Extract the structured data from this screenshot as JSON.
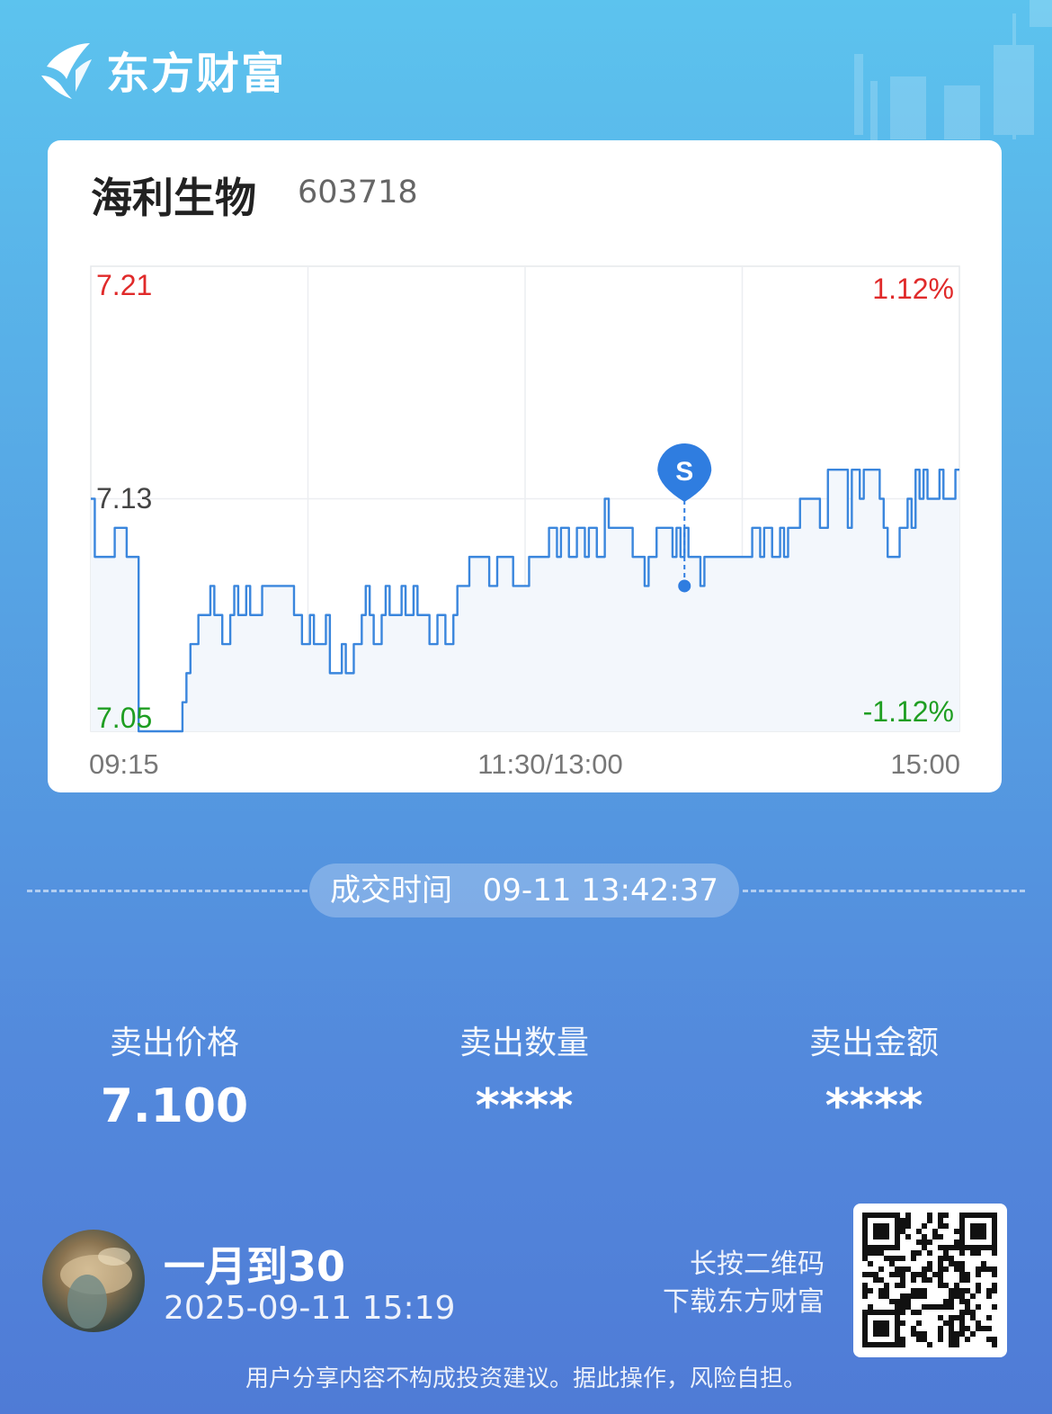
{
  "brand": {
    "name": "东方财富"
  },
  "stock": {
    "name": "海利生物",
    "code": "603718"
  },
  "chart_data": {
    "type": "line",
    "series_name": "",
    "y_top": "7.21",
    "y_mid": "7.13",
    "y_bottom": "7.05",
    "pct_top": "1.12%",
    "pct_bottom": "-1.12%",
    "x_labels": [
      "09:15",
      "11:30/13:00",
      "15:00"
    ],
    "ylim": [
      7.05,
      7.21
    ],
    "prev_close": 7.13,
    "trade_marker": {
      "label": "S",
      "x_index": 149,
      "value": 7.1
    },
    "values": [
      7.13,
      7.11,
      7.11,
      7.11,
      7.11,
      7.11,
      7.12,
      7.12,
      7.12,
      7.11,
      7.11,
      7.11,
      7.05,
      7.05,
      7.05,
      7.05,
      7.05,
      7.05,
      7.05,
      7.05,
      7.05,
      7.05,
      7.05,
      7.06,
      7.07,
      7.08,
      7.08,
      7.09,
      7.09,
      7.09,
      7.1,
      7.09,
      7.09,
      7.08,
      7.08,
      7.09,
      7.1,
      7.09,
      7.09,
      7.1,
      7.09,
      7.09,
      7.09,
      7.1,
      7.1,
      7.1,
      7.1,
      7.1,
      7.1,
      7.1,
      7.1,
      7.09,
      7.09,
      7.08,
      7.08,
      7.09,
      7.08,
      7.08,
      7.08,
      7.09,
      7.07,
      7.07,
      7.07,
      7.08,
      7.07,
      7.07,
      7.08,
      7.08,
      7.09,
      7.1,
      7.09,
      7.08,
      7.08,
      7.09,
      7.1,
      7.09,
      7.09,
      7.09,
      7.1,
      7.09,
      7.09,
      7.1,
      7.09,
      7.09,
      7.09,
      7.08,
      7.08,
      7.09,
      7.09,
      7.08,
      7.08,
      7.09,
      7.1,
      7.1,
      7.1,
      7.11,
      7.11,
      7.11,
      7.11,
      7.11,
      7.1,
      7.1,
      7.11,
      7.11,
      7.11,
      7.11,
      7.1,
      7.1,
      7.1,
      7.1,
      7.11,
      7.11,
      7.11,
      7.11,
      7.11,
      7.12,
      7.12,
      7.11,
      7.12,
      7.12,
      7.11,
      7.11,
      7.12,
      7.12,
      7.11,
      7.12,
      7.12,
      7.11,
      7.11,
      7.13,
      7.12,
      7.12,
      7.12,
      7.12,
      7.12,
      7.12,
      7.11,
      7.11,
      7.11,
      7.1,
      7.11,
      7.11,
      7.12,
      7.12,
      7.12,
      7.12,
      7.11,
      7.12,
      7.11,
      7.12,
      7.11,
      7.11,
      7.11,
      7.1,
      7.11,
      7.11,
      7.11,
      7.11,
      7.11,
      7.11,
      7.11,
      7.11,
      7.11,
      7.11,
      7.11,
      7.11,
      7.12,
      7.12,
      7.11,
      7.12,
      7.12,
      7.11,
      7.11,
      7.12,
      7.11,
      7.12,
      7.12,
      7.12,
      7.13,
      7.13,
      7.13,
      7.13,
      7.13,
      7.12,
      7.12,
      7.14,
      7.14,
      7.14,
      7.14,
      7.14,
      7.12,
      7.14,
      7.14,
      7.13,
      7.14,
      7.14,
      7.14,
      7.14,
      7.13,
      7.12,
      7.11,
      7.11,
      7.11,
      7.12,
      7.12,
      7.13,
      7.12,
      7.14,
      7.13,
      7.14,
      7.13,
      7.13,
      7.13,
      7.14,
      7.13,
      7.13,
      7.13,
      7.14,
      7.14
    ]
  },
  "trade": {
    "time_label": "成交时间",
    "time_value": "09-11 13:42:37"
  },
  "stats": [
    {
      "label": "卖出价格",
      "value": "7.100"
    },
    {
      "label": "卖出数量",
      "value": "****"
    },
    {
      "label": "卖出金额",
      "value": "****"
    }
  ],
  "user": {
    "name": "一月到30",
    "time": "2025-09-11 15:19"
  },
  "qr": {
    "line1": "长按二维码",
    "line2": "下载东方财富"
  },
  "disclaimer": "用户分享内容不构成投资建议。据此操作，风险自担。",
  "colors": {
    "up": "#e02a2a",
    "down": "#1f9e22",
    "line": "#3a86dd",
    "accent": "#2f7de0"
  }
}
